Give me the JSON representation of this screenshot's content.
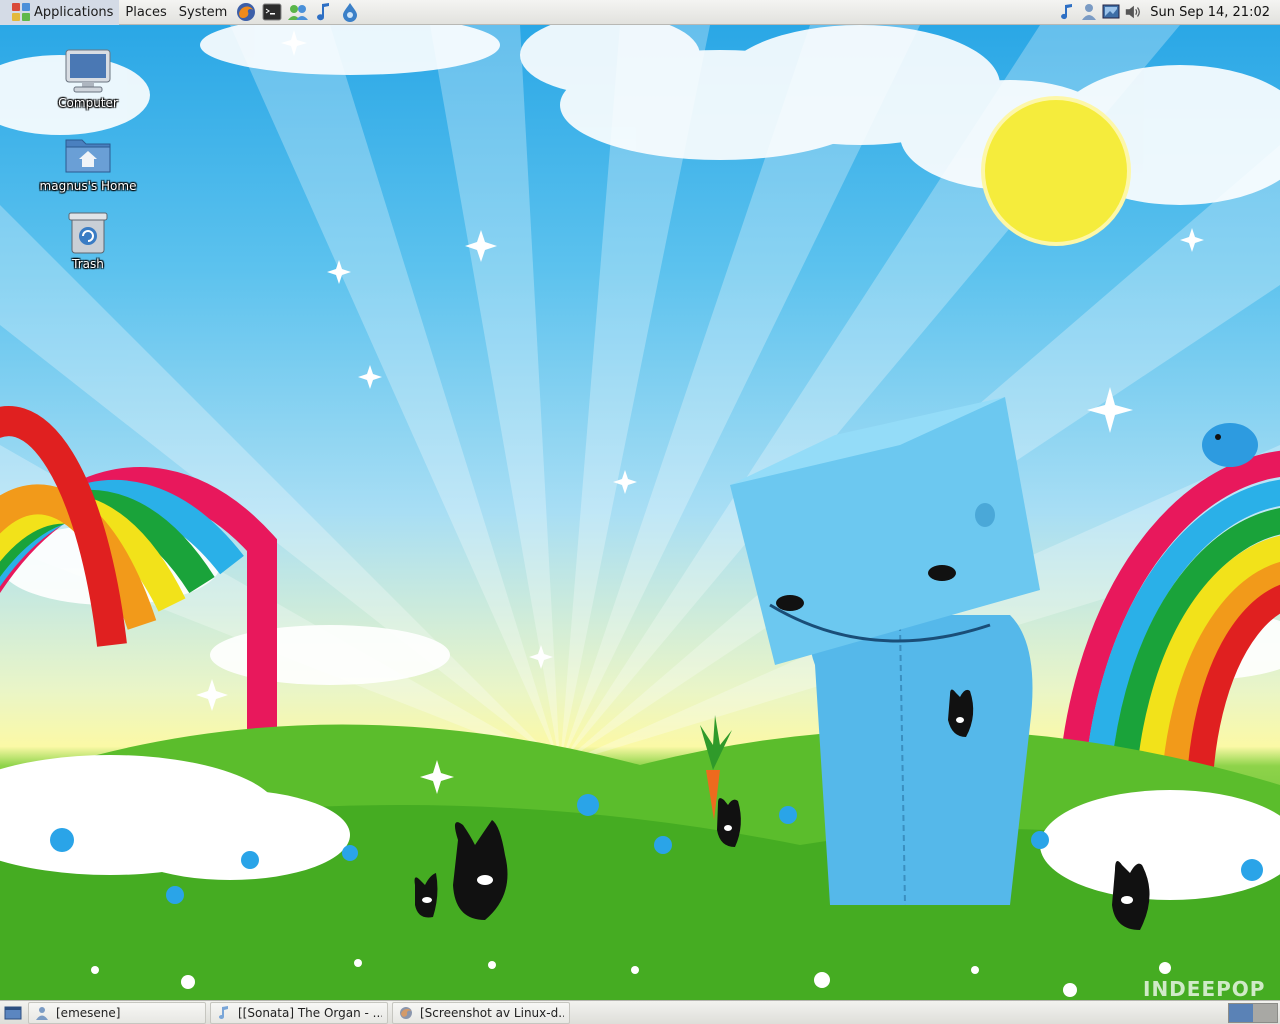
{
  "top_panel": {
    "menus": [
      "Applications",
      "Places",
      "System"
    ],
    "launchers": [
      "firefox-icon",
      "terminal-icon",
      "emesene-icon",
      "sonata-icon",
      "pidgin-drop-icon"
    ],
    "tray_icons": [
      "music-note-icon",
      "user-icon",
      "network-icon",
      "volume-icon"
    ],
    "clock": "Sun Sep 14, 21:02"
  },
  "desktop": {
    "icons": [
      {
        "label": "Computer",
        "icon": "computer-icon"
      },
      {
        "label": "magnus's Home",
        "icon": "home-folder-icon"
      },
      {
        "label": "Trash",
        "icon": "trash-icon"
      }
    ],
    "watermark": "INDEEPOP"
  },
  "bottom_panel": {
    "tasks": [
      {
        "label": "[emesene]",
        "icon": "emesene-icon"
      },
      {
        "label": "[[Sonata] The Organ - ...",
        "icon": "sonata-icon"
      },
      {
        "label": "[Screenshot av Linux-d...",
        "icon": "firefox-icon"
      }
    ],
    "workspaces": 2,
    "active_workspace": 1
  },
  "colors": {
    "panel": "#e8e8e4",
    "sky": "#2aa7e6",
    "grass": "#53b82a",
    "rainbow_red": "#e8185c",
    "sun": "#f7ee3a"
  }
}
